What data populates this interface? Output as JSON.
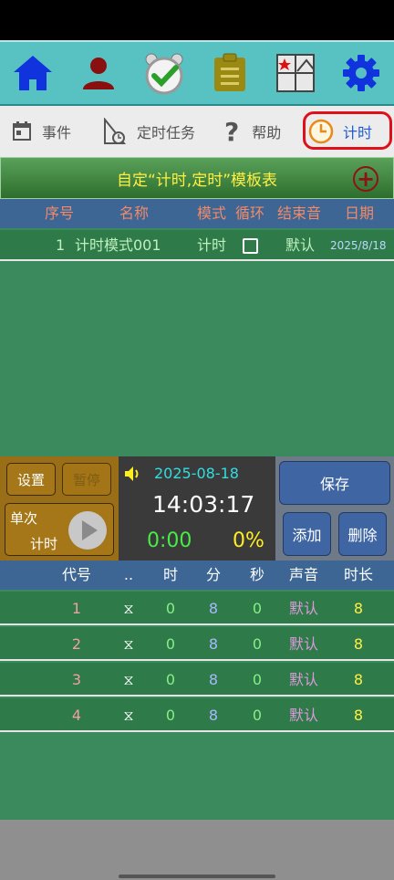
{
  "toolbar": {
    "icons": [
      "home-icon",
      "person-icon",
      "alarm-check-icon",
      "clipboard-icon",
      "chart-board-icon",
      "gear-icon"
    ]
  },
  "tabs": [
    {
      "label": "事件",
      "icon": "calendar-icon"
    },
    {
      "label": "定时任务",
      "icon": "timer-task-icon"
    },
    {
      "label": "帮助",
      "icon": "question-icon"
    },
    {
      "label": "计时",
      "icon": "clock-icon"
    }
  ],
  "template": {
    "title": "自定“计时,定时”模板表",
    "add_icon": "plus-circle-icon"
  },
  "template_table": {
    "headers": [
      "序号",
      "名称",
      "模式",
      "循环",
      "结束音",
      "日期"
    ],
    "rows": [
      {
        "index": "1",
        "name": "计时模式001",
        "mode": "计时",
        "loop": false,
        "sound": "默认",
        "date": "2025/8/18"
      }
    ]
  },
  "control": {
    "setup_label": "设置",
    "pause_label": "暂停",
    "mode_line1": "单次",
    "mode_line2": "计时",
    "date": "2025-08-18",
    "time": "14:03:17",
    "elapsed": "0:00",
    "percent": "0%",
    "save_label": "保存",
    "add_label": "添加",
    "delete_label": "删除"
  },
  "step_table": {
    "headers": [
      "代号",
      "..",
      "时",
      "分",
      "秒",
      "声音",
      "时长"
    ],
    "rows": [
      {
        "code": "1",
        "icon": "⧖",
        "h": "0",
        "m": "8",
        "s": "0",
        "sound": "默认",
        "duration": "8"
      },
      {
        "code": "2",
        "icon": "⧖",
        "h": "0",
        "m": "8",
        "s": "0",
        "sound": "默认",
        "duration": "8"
      },
      {
        "code": "3",
        "icon": "⧖",
        "h": "0",
        "m": "8",
        "s": "0",
        "sound": "默认",
        "duration": "8"
      },
      {
        "code": "4",
        "icon": "⧖",
        "h": "0",
        "m": "8",
        "s": "0",
        "sound": "默认",
        "duration": "8"
      }
    ]
  },
  "colors": {
    "toolbar_bg": "#58c2c2",
    "header_blue": "#3d6694",
    "row_green": "#2e7a48",
    "title_yellow": "#ffee44",
    "clock_green": "#44ee44",
    "percent_yellow": "#ffee22",
    "date_cyan": "#33dddd",
    "highlight_red": "#e0101a"
  }
}
